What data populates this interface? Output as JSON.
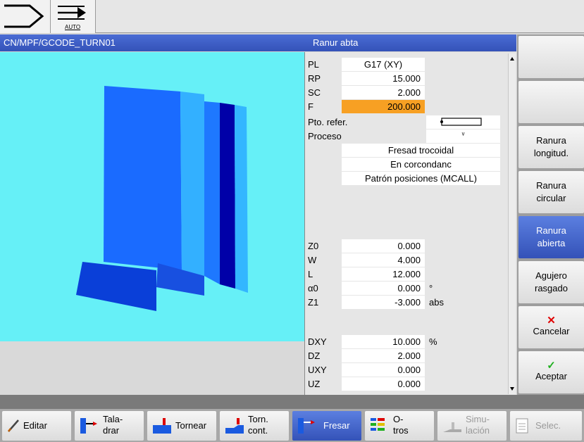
{
  "topbar": {
    "mode_label": "AUTO"
  },
  "header": {
    "path": "CN/MPF/GCODE_TURN01",
    "cycle_title": "Ranur abta"
  },
  "params": {
    "PL": {
      "label": "PL",
      "value": "G17 (XY)"
    },
    "RP": {
      "label": "RP",
      "value": "15.000"
    },
    "SC": {
      "label": "SC",
      "value": "2.000"
    },
    "F": {
      "label": "F",
      "value": "200.000"
    },
    "pto": {
      "label": "Pto. refer."
    },
    "proceso": {
      "label": "Proceso",
      "marker": "ᵛ"
    },
    "machining": "Fresad trocoidal",
    "direction": "En corcondanc",
    "pattern": "Patrón posiciones (MCALL)",
    "Z0": {
      "label": "Z0",
      "value": "0.000"
    },
    "W": {
      "label": "W",
      "value": "4.000"
    },
    "L": {
      "label": "L",
      "value": "12.000"
    },
    "a0": {
      "label": "α0",
      "value": "0.000",
      "unit": "°"
    },
    "Z1": {
      "label": "Z1",
      "value": "-3.000",
      "unit": "abs"
    },
    "DXY": {
      "label": "DXY",
      "value": "10.000",
      "unit": "%"
    },
    "DZ": {
      "label": "DZ",
      "value": "2.000"
    },
    "UXY": {
      "label": "UXY",
      "value": "0.000"
    },
    "UZ": {
      "label": "UZ",
      "value": "0.000"
    }
  },
  "softkeys": {
    "ranura_longitud": [
      "Ranura",
      "longitud."
    ],
    "ranura_circular": [
      "Ranura",
      "circular"
    ],
    "ranura_abierta": [
      "Ranura",
      "abierta"
    ],
    "agujero_rasgado": [
      "Agujero",
      "rasgado"
    ],
    "cancelar": "Cancelar",
    "aceptar": "Aceptar"
  },
  "hkeys": {
    "editar": "Editar",
    "taladrar": [
      "Tala-",
      "drar"
    ],
    "tornear": "Tornear",
    "torn_cont": [
      "Torn.",
      "cont."
    ],
    "fresar": "Fresar",
    "otros": [
      "O-",
      "tros"
    ],
    "simulacion": [
      "Simu-",
      "lación"
    ],
    "selec": "Selec."
  },
  "colors": {
    "accent": "#3452b8",
    "highlight": "#f7a023",
    "graphic_bg": "#66f0f7"
  }
}
